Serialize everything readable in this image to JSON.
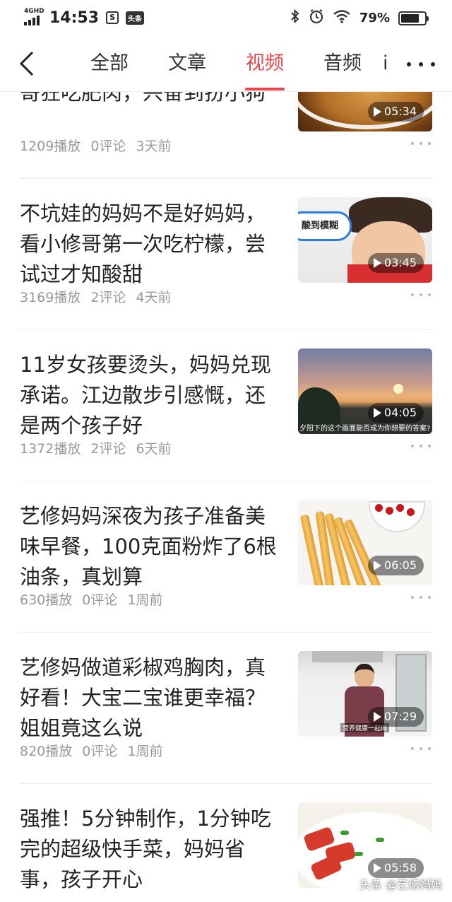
{
  "status_bar": {
    "network": "4GHD",
    "time": "14:53",
    "app_icon_label": "头条",
    "battery_pct": "79%",
    "battery_level": 0.79,
    "icons": [
      "bluetooth-icon",
      "alarm-icon",
      "wifi-icon"
    ]
  },
  "nav": {
    "tabs": [
      {
        "label": "全部",
        "active": false
      },
      {
        "label": "文章",
        "active": false
      },
      {
        "label": "视频",
        "active": true
      },
      {
        "label": "音频",
        "active": false
      },
      {
        "label": "i",
        "active": false
      }
    ]
  },
  "accent_color": "#e8474c",
  "feed": {
    "items": [
      {
        "title": "吉祥如意，味道绝了。小修哥狂吃肥肉，兴奋到扮小狗",
        "plays": "1209播放",
        "comments": "0评论",
        "time": "3天前",
        "duration": "05:34"
      },
      {
        "title": "不坑娃的妈妈不是好妈妈，看小修哥第一次吃柠檬，尝试过才知酸甜",
        "plays": "3169播放",
        "comments": "2评论",
        "time": "4天前",
        "duration": "03:45",
        "thumb_text": "酸到模糊"
      },
      {
        "title": "11岁女孩要烫头，妈妈兑现承诺。江边散步引感慨，还是两个孩子好",
        "plays": "1372播放",
        "comments": "2评论",
        "time": "6天前",
        "duration": "04:05",
        "thumb_text": "夕阳下的这个画面能否成为你想要的答案?"
      },
      {
        "title": "艺修妈妈深夜为孩子准备美味早餐，100克面粉炸了6根油条，真划算",
        "plays": "630播放",
        "comments": "0评论",
        "time": "1周前",
        "duration": "06:05"
      },
      {
        "title": "艺修妈做道彩椒鸡胸肉，真好看！大宝二宝谁更幸福？姐姐竟这么说",
        "plays": "820播放",
        "comments": "0评论",
        "time": "1周前",
        "duration": "07:29",
        "thumb_text": "营养健康一起做"
      },
      {
        "title": "强推！5分钟制作，1分钟吃完的超级快手菜，妈妈省事，孩子开心",
        "plays": "",
        "comments": "",
        "time": "",
        "duration": "05:58"
      }
    ]
  },
  "watermark": "头条 @艺修妈妈"
}
